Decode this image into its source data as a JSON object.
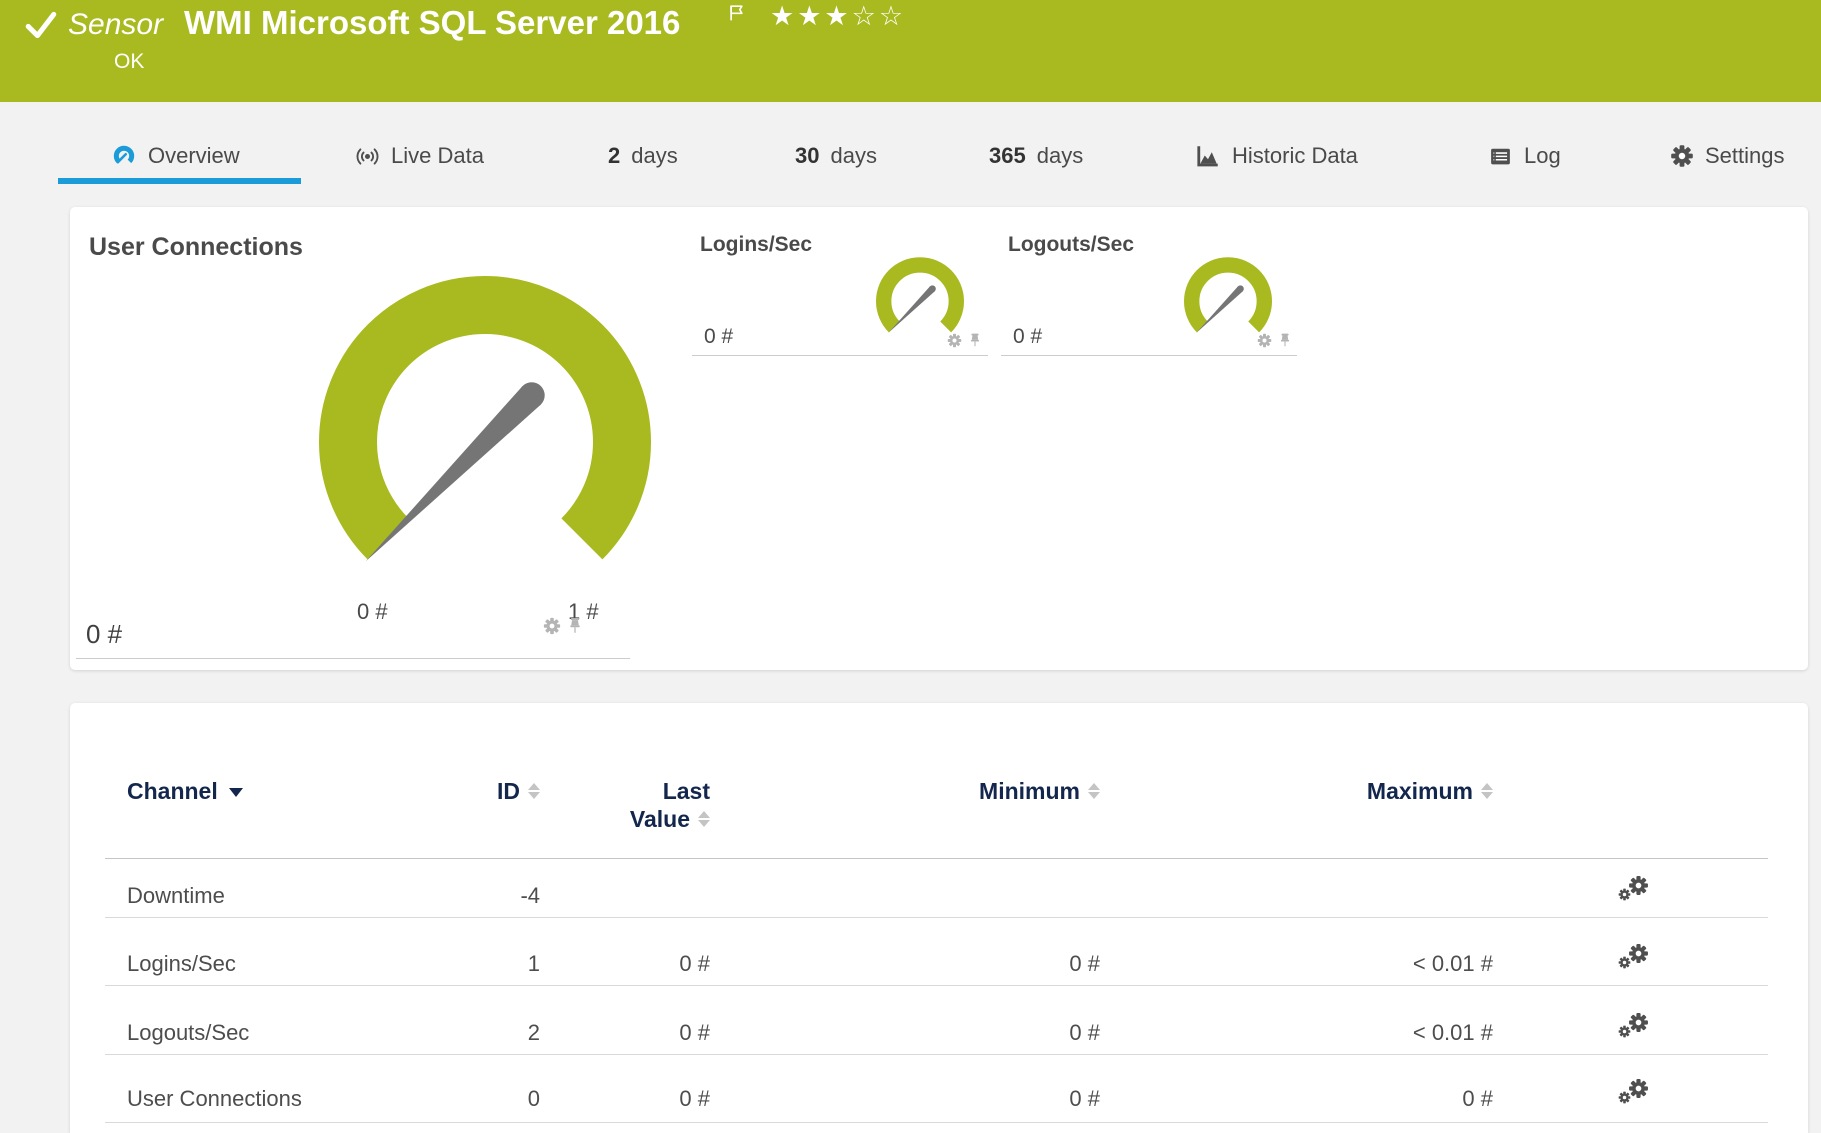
{
  "page_bg": "#f2f2f2",
  "header": {
    "accent_color": "#a9ba20",
    "sensor_label": "Sensor",
    "title": "WMI Microsoft SQL Server 2016",
    "status": "OK",
    "stars": "★★★☆☆",
    "rating_filled": 3,
    "rating_total": 5
  },
  "accent_blue": "#1b9cd9",
  "tabs": [
    {
      "label": "Overview"
    },
    {
      "label": "Live Data"
    },
    {
      "num": "2",
      "label": "days"
    },
    {
      "num": "30",
      "label": "days"
    },
    {
      "num": "365",
      "label": "days"
    },
    {
      "label": "Historic Data"
    },
    {
      "label": "Log"
    },
    {
      "label": "Settings"
    }
  ],
  "gauges": {
    "gauge_color": "#a9ba20",
    "needle_color": "#757575",
    "primary": {
      "title": "User Connections",
      "value": "0 #",
      "min_label": "0 #",
      "max_label": "1 #"
    },
    "secondary": [
      {
        "title": "Logins/Sec",
        "value": "0 #"
      },
      {
        "title": "Logouts/Sec",
        "value": "0 #"
      }
    ]
  },
  "table": {
    "header": {
      "channel": "Channel",
      "id": "ID",
      "last_line1": "Last",
      "last_line2": "Value",
      "min": "Minimum",
      "max": "Maximum"
    },
    "rows": [
      {
        "channel": "Downtime",
        "id": "-4",
        "last": "",
        "min": "",
        "max": ""
      },
      {
        "channel": "Logins/Sec",
        "id": "1",
        "last": "0 #",
        "min": "0 #",
        "max": "< 0.01 #"
      },
      {
        "channel": "Logouts/Sec",
        "id": "2",
        "last": "0 #",
        "min": "0 #",
        "max": "< 0.01 #"
      },
      {
        "channel": "User Connections",
        "id": "0",
        "last": "0 #",
        "min": "0 #",
        "max": "0 #"
      }
    ]
  }
}
